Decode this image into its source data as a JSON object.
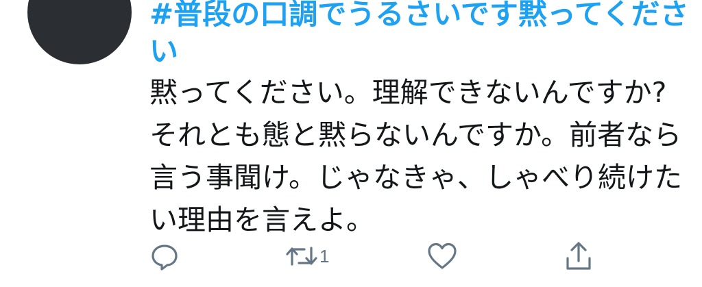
{
  "tweet": {
    "hashtag": "#普段の口調でうるさいです黙ってください",
    "text": "黙ってください。理解できないんですか?それとも態と黙らないんですか。前者なら言う事聞け。じゃなきゃ、しゃべり続けたい理由を言えよ。"
  },
  "actions": {
    "reply_icon": "reply-icon",
    "retweet_icon": "retweet-icon",
    "retweet_count": "1",
    "like_icon": "heart-icon",
    "share_icon": "share-icon"
  },
  "colors": {
    "hashtag": "#1da1f2",
    "text": "#14171a",
    "icon": "#657786",
    "avatar": "#2b2f33"
  }
}
